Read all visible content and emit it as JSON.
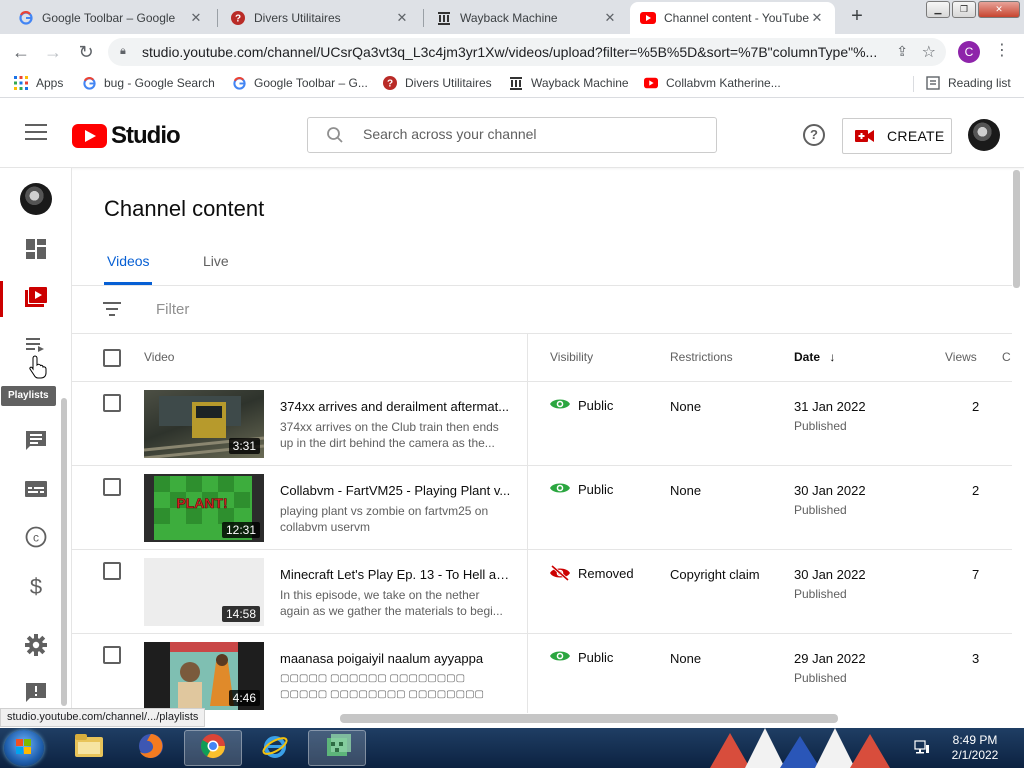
{
  "browser": {
    "tabs": [
      {
        "title": "Google Toolbar – Google",
        "icon": "google-g-icon",
        "active": false
      },
      {
        "title": "Divers Utilitaires",
        "icon": "quora-icon",
        "active": false
      },
      {
        "title": "Wayback Machine",
        "icon": "wayback-icon",
        "active": false
      },
      {
        "title": "Channel content - YouTube",
        "icon": "youtube-icon",
        "active": true
      }
    ],
    "new_tab": "+",
    "window_buttons": {
      "minimize": "▁",
      "restore": "❐",
      "close": "✕"
    },
    "url": "studio.youtube.com/channel/UCsrQa3vt3q_L3c4jm3yr1Xw/videos/upload?filter=%5B%5D&sort=%7B\"columnType\"%...",
    "profile_letter": "C",
    "bookmarks": [
      {
        "label": "Apps",
        "icon": "apps-grid-icon"
      },
      {
        "label": "bug - Google Search",
        "icon": "google-g-icon"
      },
      {
        "label": "Google Toolbar – G...",
        "icon": "google-g-icon"
      },
      {
        "label": "Divers Utilitaires",
        "icon": "quora-icon"
      },
      {
        "label": "Wayback Machine",
        "icon": "wayback-icon"
      },
      {
        "label": "Collabvm Katherine...",
        "icon": "youtube-icon"
      }
    ],
    "reading_list": "Reading list",
    "status_url": "studio.youtube.com/channel/.../playlists"
  },
  "studio": {
    "logo_text": "Studio",
    "search_placeholder": "Search across your channel",
    "help": "?",
    "create_label": "CREATE",
    "tooltip": "Playlists",
    "rail_items": [
      {
        "name": "dashboard",
        "icon": "dashboard-icon"
      },
      {
        "name": "content",
        "icon": "content-icon",
        "active": true
      },
      {
        "name": "playlists",
        "icon": "playlists-icon"
      },
      {
        "name": "comments",
        "icon": "comments-icon"
      },
      {
        "name": "subtitles",
        "icon": "subtitles-icon"
      },
      {
        "name": "copyright",
        "icon": "copyright-icon"
      },
      {
        "name": "earn",
        "icon": "dollar-icon"
      },
      {
        "name": "settings",
        "icon": "gear-icon"
      },
      {
        "name": "feedback",
        "icon": "feedback-icon"
      }
    ]
  },
  "content": {
    "title": "Channel content",
    "tabs": [
      "Videos",
      "Live"
    ],
    "filter_placeholder": "Filter",
    "columns": {
      "video": "Video",
      "visibility": "Visibility",
      "restrictions": "Restrictions",
      "date": "Date",
      "views": "Views",
      "comments_partial": "C"
    },
    "videos": [
      {
        "title": "374xx arrives and derailment aftermat...",
        "description": "374xx arrives on the Club train then ends up in the dirt behind the camera as the...",
        "duration": "3:31",
        "visibility": "Public",
        "visibility_icon": "eye-icon",
        "restrictions": "None",
        "date": "31 Jan 2022",
        "status": "Published",
        "views": "2"
      },
      {
        "title": "Collabvm - FartVM25 - Playing Plant v...",
        "description": "playing plant vs zombie on fartvm25 on collabvm uservm",
        "duration": "12:31",
        "thumb_text": "PLANT!",
        "visibility": "Public",
        "visibility_icon": "eye-icon",
        "restrictions": "None",
        "date": "30 Jan 2022",
        "status": "Published",
        "views": "2"
      },
      {
        "title": "Minecraft Let's Play Ep. 13 - To Hell an...",
        "description": "In this episode, we take on the nether again as we gather the materials to begi...",
        "duration": "14:58",
        "visibility": "Removed",
        "visibility_icon": "eye-off-icon",
        "restrictions": "Copyright claim",
        "date": "30 Jan 2022",
        "status": "Published",
        "views": "7"
      },
      {
        "title": "maanasa poigaiyil naalum ayyappa",
        "description": "▢▢▢▢▢ ▢▢▢▢▢▢ ▢▢▢▢▢▢▢▢ ▢▢▢▢▢ ▢▢▢▢▢▢▢▢ ▢▢▢▢▢▢▢▢ ▢▢▢▢▢▢▢▢ ▢▢▢▢▢▢▢▢ ▢▢▢▢▢ ▢▢▢",
        "duration": "4:46",
        "visibility": "Public",
        "visibility_icon": "eye-icon",
        "restrictions": "None",
        "date": "29 Jan 2022",
        "status": "Published",
        "views": "3"
      }
    ]
  },
  "taskbar": {
    "time": "8:49 PM",
    "date": "2/1/2022",
    "apps": [
      "windows-explorer-icon",
      "firefox-icon",
      "chrome-icon",
      "internet-explorer-icon",
      "app-icon"
    ]
  },
  "colors": {
    "accent_blue": "#065fd4",
    "youtube_red": "#ff0000",
    "public_green": "#2ba640",
    "removed_red": "#cc0000"
  }
}
